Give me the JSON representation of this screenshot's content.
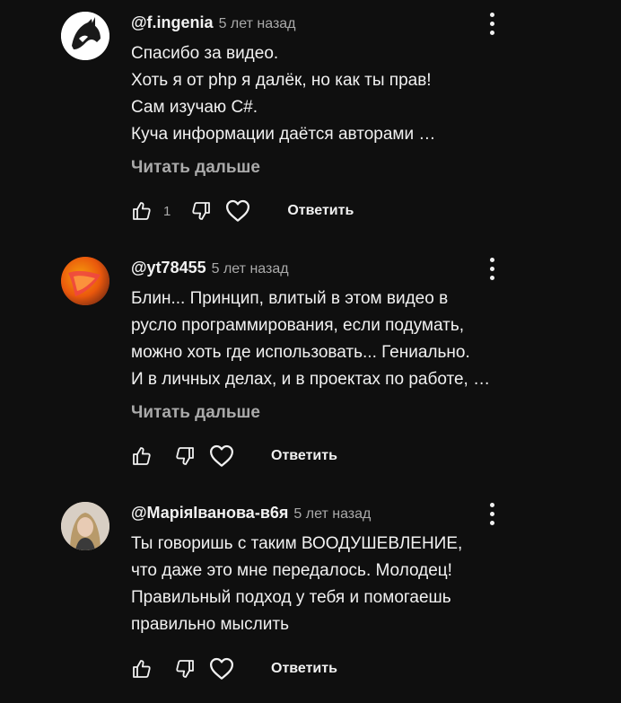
{
  "comments": [
    {
      "author": "@f.ingenia",
      "time": "5 лет назад",
      "lines": [
        "Спасибо за видео.",
        "Хоть я от php я далёк, но как ты прав!",
        "Сам изучаю C#.",
        "Куча информации даётся авторами …"
      ],
      "read_more": "Читать дальше",
      "like_count": "1",
      "reply_label": "Ответить"
    },
    {
      "author": "@yt78455",
      "time": "5 лет назад",
      "lines": [
        "Блин... Принцип, влитый в этом видео в",
        "русло программирования, если подумать,",
        "можно хоть где использовать... Гениально.",
        "И в личных делах, и в проектах по работе, …"
      ],
      "read_more": "Читать дальше",
      "reply_label": "Ответить"
    },
    {
      "author": "@МаріяІванова-в6я",
      "time": "5 лет назад",
      "lines": [
        "Ты говоришь с таким ВООДУШЕВЛЕНИЕ,",
        "что даже это мне передалось. Молодец!",
        "Правильный подход у тебя и  помогаешь",
        "правильно мыслить"
      ],
      "reply_label": "Ответить"
    }
  ],
  "icons": [
    "avatar-wolf",
    "avatar-orange",
    "avatar-photo",
    "kebab-menu-icon",
    "thumb-up-icon",
    "thumb-down-icon",
    "heart-icon"
  ]
}
